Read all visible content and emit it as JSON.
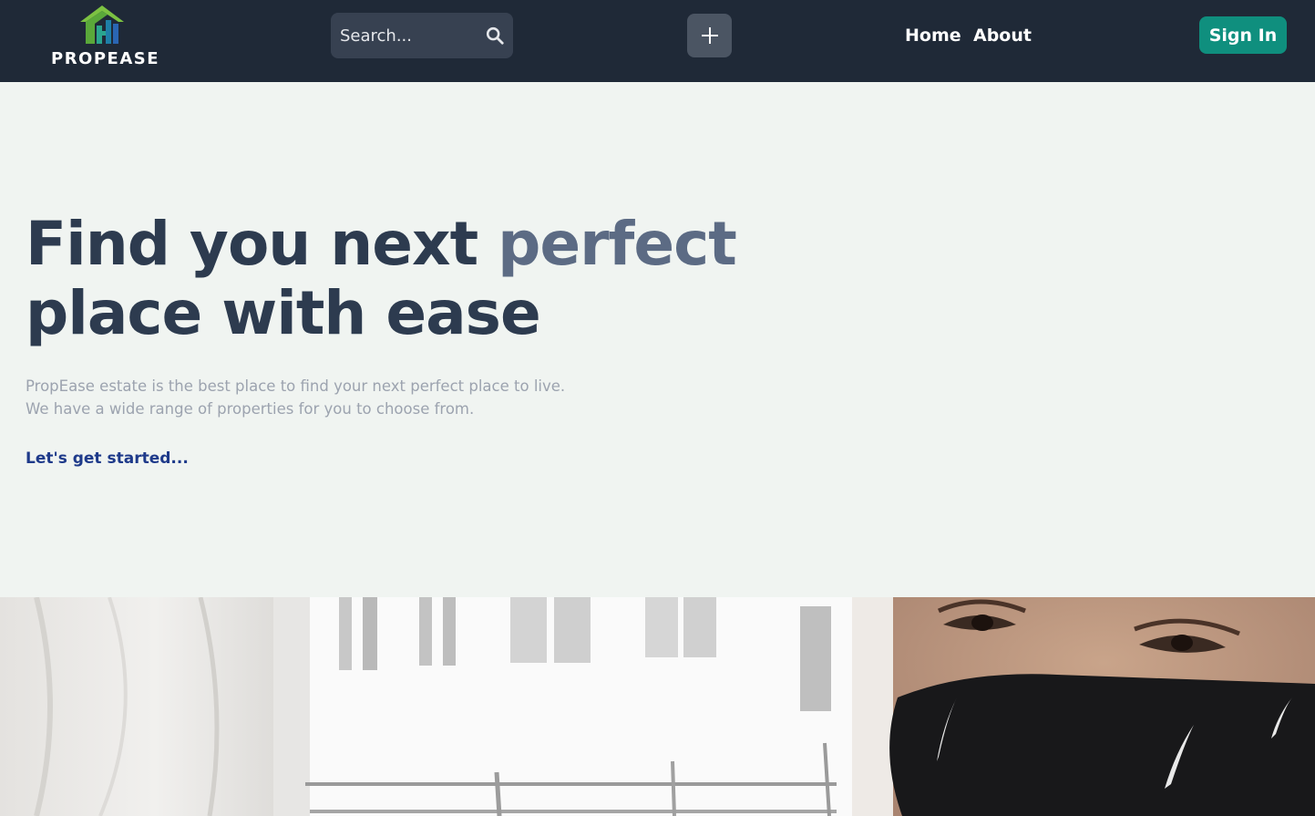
{
  "brand": {
    "name": "PROPEASE",
    "logo_icon": "house-logo-icon",
    "colors": {
      "header_bg": "#1f2937",
      "accent": "#0f8f7e",
      "link": "#1e3a8a"
    }
  },
  "header": {
    "search": {
      "placeholder": "Search...",
      "icon": "search-icon"
    },
    "add_button": {
      "icon": "plus-icon"
    },
    "nav": [
      {
        "label": "Home"
      },
      {
        "label": "About"
      }
    ],
    "signin_label": "Sign In"
  },
  "hero": {
    "title_part1": "Find you next ",
    "title_accent": "perfect",
    "title_part2": "place with ease",
    "description_line1": "PropEase estate is the best place to find your next perfect place to live.",
    "description_line2": "We have a wide range of properties for you to choose from.",
    "cta_label": "Let's get started..."
  }
}
